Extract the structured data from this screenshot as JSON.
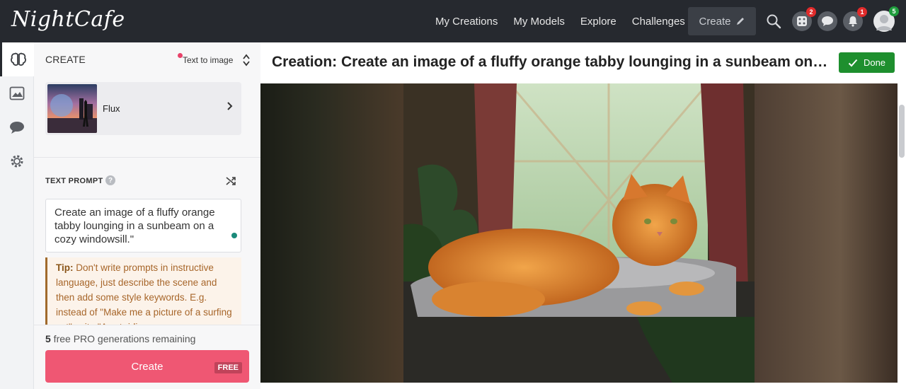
{
  "app": {
    "logo": "NightCafe"
  },
  "nav": {
    "links": [
      "My Creations",
      "My Models",
      "Explore",
      "Challenges"
    ],
    "create_label": "Create",
    "badges": {
      "dice": "2",
      "notifications": "1",
      "avatar": "5"
    }
  },
  "panel": {
    "title": "CREATE",
    "mode": "Text to image",
    "model_name": "Flux",
    "text_prompt_label": "TEXT PROMPT",
    "help_glyph": "?",
    "prompt_text": "Create an image of a fluffy orange tabby lounging in a sunbeam on a cozy windowsill.\"",
    "tip_label": "Tip:",
    "tip_text": " Don't write prompts in instructive language, just describe the scene and then add some style keywords. E.g. instead of \"Make me a picture of a surfing cat\" write \"A cat riding a",
    "remaining_count": "5",
    "remaining_text": " free PRO generations remaining",
    "create_button": "Create",
    "free_tag": "FREE"
  },
  "main": {
    "title": "Creation: Create an image of a fluffy orange tabby lounging in a sunbeam on a cozy windowsill.\"",
    "done_label": "Done"
  },
  "colors": {
    "nav_bg": "#26292f",
    "create_pink": "#ef5773",
    "done_green": "#1e8f2e",
    "tip_brown": "#a7662a"
  },
  "icons": [
    "search-icon",
    "dice-icon",
    "chat-icon",
    "bell-icon",
    "avatar-icon",
    "brain-icon",
    "gallery-icon",
    "message-icon",
    "gear-icon",
    "shuffle-icon",
    "chevron-right-icon",
    "check-icon",
    "pencil-icon"
  ]
}
